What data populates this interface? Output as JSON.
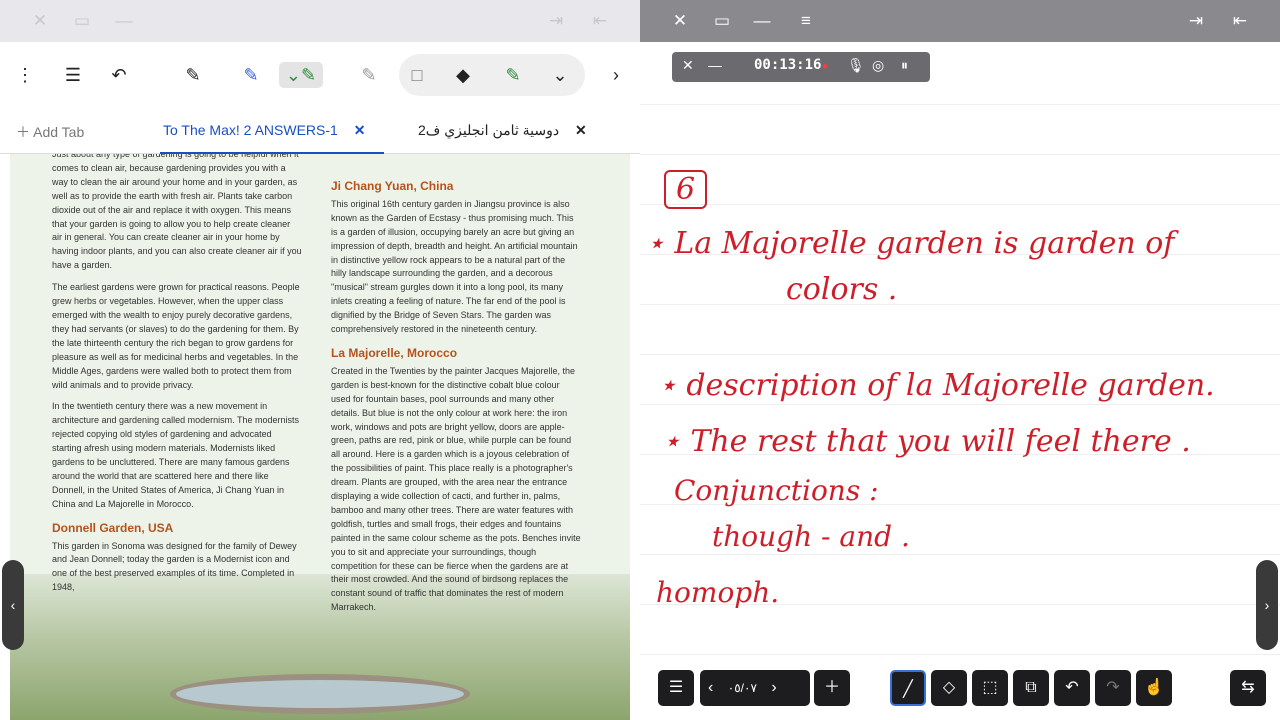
{
  "left_toolbar": {
    "add_tab": "Add Tab",
    "tab_active": "To The Max! 2 ANSWERS-1",
    "tab_other": "دوسية ثامن انجليزي ف2"
  },
  "page": {
    "intro": "Just about any type of gardening is going to be helpful when it comes to clean air, because gardening provides you with a way to clean the air around your home and in your garden, as well as to provide the earth with fresh air. Plants take carbon dioxide out of the air and replace it with oxygen. This means that your garden is going to allow you to help create cleaner air in general. You can create cleaner air in your home by having indoor plants, and you can also create cleaner air if you have a garden.",
    "p2": "The earliest gardens were grown for practical reasons. People grew herbs or vegetables. However, when the upper class emerged with the wealth to enjoy purely decorative gardens, they had servants (or slaves) to do the gardening for them. By the late thirteenth century the rich began to grow gardens for pleasure as well as for medicinal herbs and vegetables. In the Middle Ages, gardens were walled both to protect them from wild animals and to provide privacy.",
    "p3": "In the twentieth century there was a new movement in architecture and gardening called modernism. The modernists rejected copying old styles of gardening and advocated starting afresh using modern materials. Modernists liked gardens to be uncluttered. There are many famous gardens around the world that are scattered here and there like Donnell, in the United States of America, Ji Chang Yuan in China and La Majorelle in Morocco.",
    "h_donnell": "Donnell Garden, USA",
    "donnell": "This garden in Sonoma was designed for the family of Dewey and Jean Donnell; today the garden is a Modernist icon and one of the best preserved examples of its time. Completed in 1948,",
    "h_ji": "Ji Chang Yuan, China",
    "ji": "This original 16th century garden in Jiangsu province is also known as the Garden of Ecstasy - thus promising much. This is a garden of illusion, occupying barely an acre but giving an impression of depth, breadth and height. An artificial mountain in distinctive yellow rock appears to be a natural part of the hilly landscape surrounding the garden, and a decorous \"musical\" stream gurgles down it into a long pool, its many inlets creating a feeling of nature. The far end of the pool is dignified by the Bridge of Seven Stars. The garden was comprehensively restored in the nineteenth century.",
    "h_la": "La Majorelle, Morocco",
    "la": "Created in the Twenties by the painter Jacques Majorelle, the garden is best-known for the distinctive cobalt blue colour used for fountain bases, pool surrounds and many other details. But blue is not the only colour at work here: the iron work, windows and pots are bright yellow, doors are apple-green, paths are red, pink or blue, while purple can be found all around. Here is a garden which is a joyous celebration of the possibilities of paint. This place really is a photographer's dream. Plants are grouped, with the area near the entrance displaying a wide collection of cacti, and further in, palms, bamboo and many other trees. There are water features with goldfish, turtles and small frogs, their edges and fountains painted in the same colour scheme as the pots. Benches invite you to sit and appreciate your surroundings, though competition for these can be fierce when the gardens are at their most crowded. And the sound of birdsong replaces the constant sound of traffic that dominates the rest of modern Marrakech."
  },
  "recorder": {
    "time": "00:13:16"
  },
  "notes": {
    "n6": "6",
    "l1": "La Majorelle garden is garden of",
    "l2": "colors .",
    "l3": "description of la Majorelle garden.",
    "l4": "The rest that you will feel there .",
    "l5": "Conjunctions :",
    "l6": "though - and .",
    "l7": "homoph."
  },
  "bottom": {
    "page_indicator": "٠٥/٠٧"
  },
  "colors": {
    "ink_red": "#cc1f2a",
    "tab_blue": "#1a4fc2",
    "heading_orange": "#b5531b"
  }
}
